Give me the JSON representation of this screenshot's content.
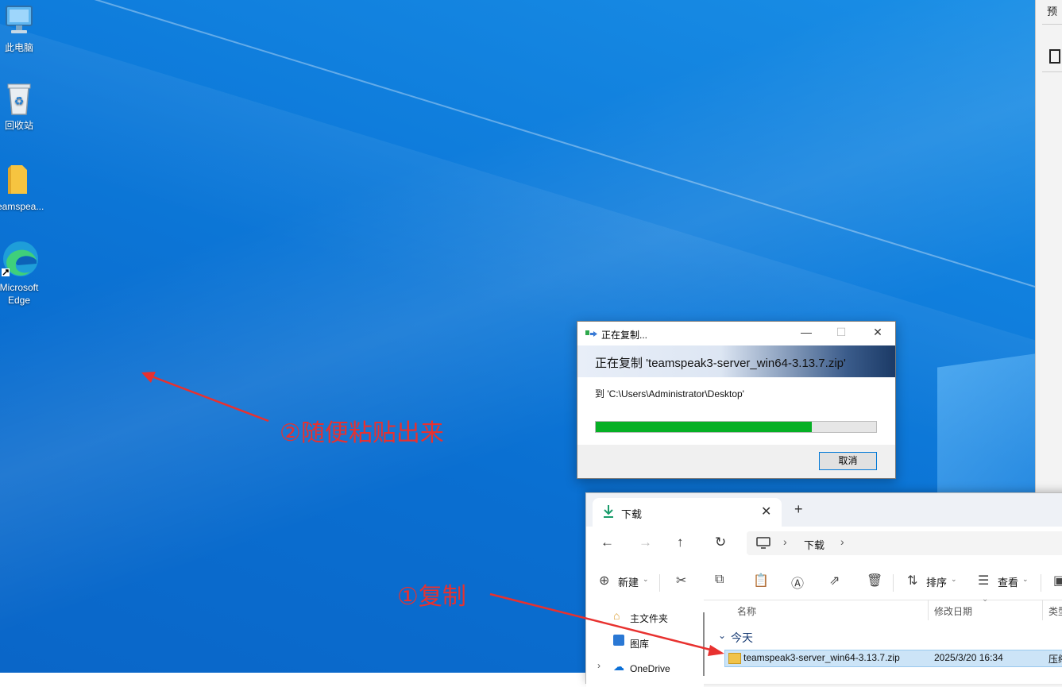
{
  "desktop": {
    "icons": [
      {
        "label": "此电脑",
        "icon": "computer-icon"
      },
      {
        "label": "回收站",
        "icon": "recycle-bin-icon"
      },
      {
        "label": "teamspea...",
        "icon": "folder-icon"
      },
      {
        "label": "Microsoft Edge",
        "icon": "edge-icon"
      }
    ]
  },
  "right_window": {
    "title_char": "预"
  },
  "copy_dialog": {
    "title": "正在复制...",
    "heading": "正在复制 'teamspeak3-server_win64-3.13.7.zip'",
    "destination": "到 'C:\\Users\\Administrator\\Desktop'",
    "progress": 0.77,
    "cancel_label": "取消",
    "minimize": "—",
    "maximize": "☐",
    "close": "✕"
  },
  "explorer": {
    "tab_label": "下载",
    "tab_close": "✕",
    "new_tab": "+",
    "breadcrumb": "下载",
    "commands": {
      "new": "新建",
      "sort": "排序",
      "view": "查看"
    },
    "sidebar": [
      "主文件夹",
      "图库",
      "OneDrive"
    ],
    "columns": {
      "name": "名称",
      "modified": "修改日期",
      "type": "类型"
    },
    "group": "今天",
    "files": [
      {
        "name": "teamspeak3-server_win64-3.13.7.zip",
        "modified": "2025/3/20 16:34",
        "type": "压缩"
      }
    ]
  },
  "annotations": {
    "step1": "①复制",
    "step2": "②随便粘贴出来",
    "arrow_color": "#e8312f"
  }
}
